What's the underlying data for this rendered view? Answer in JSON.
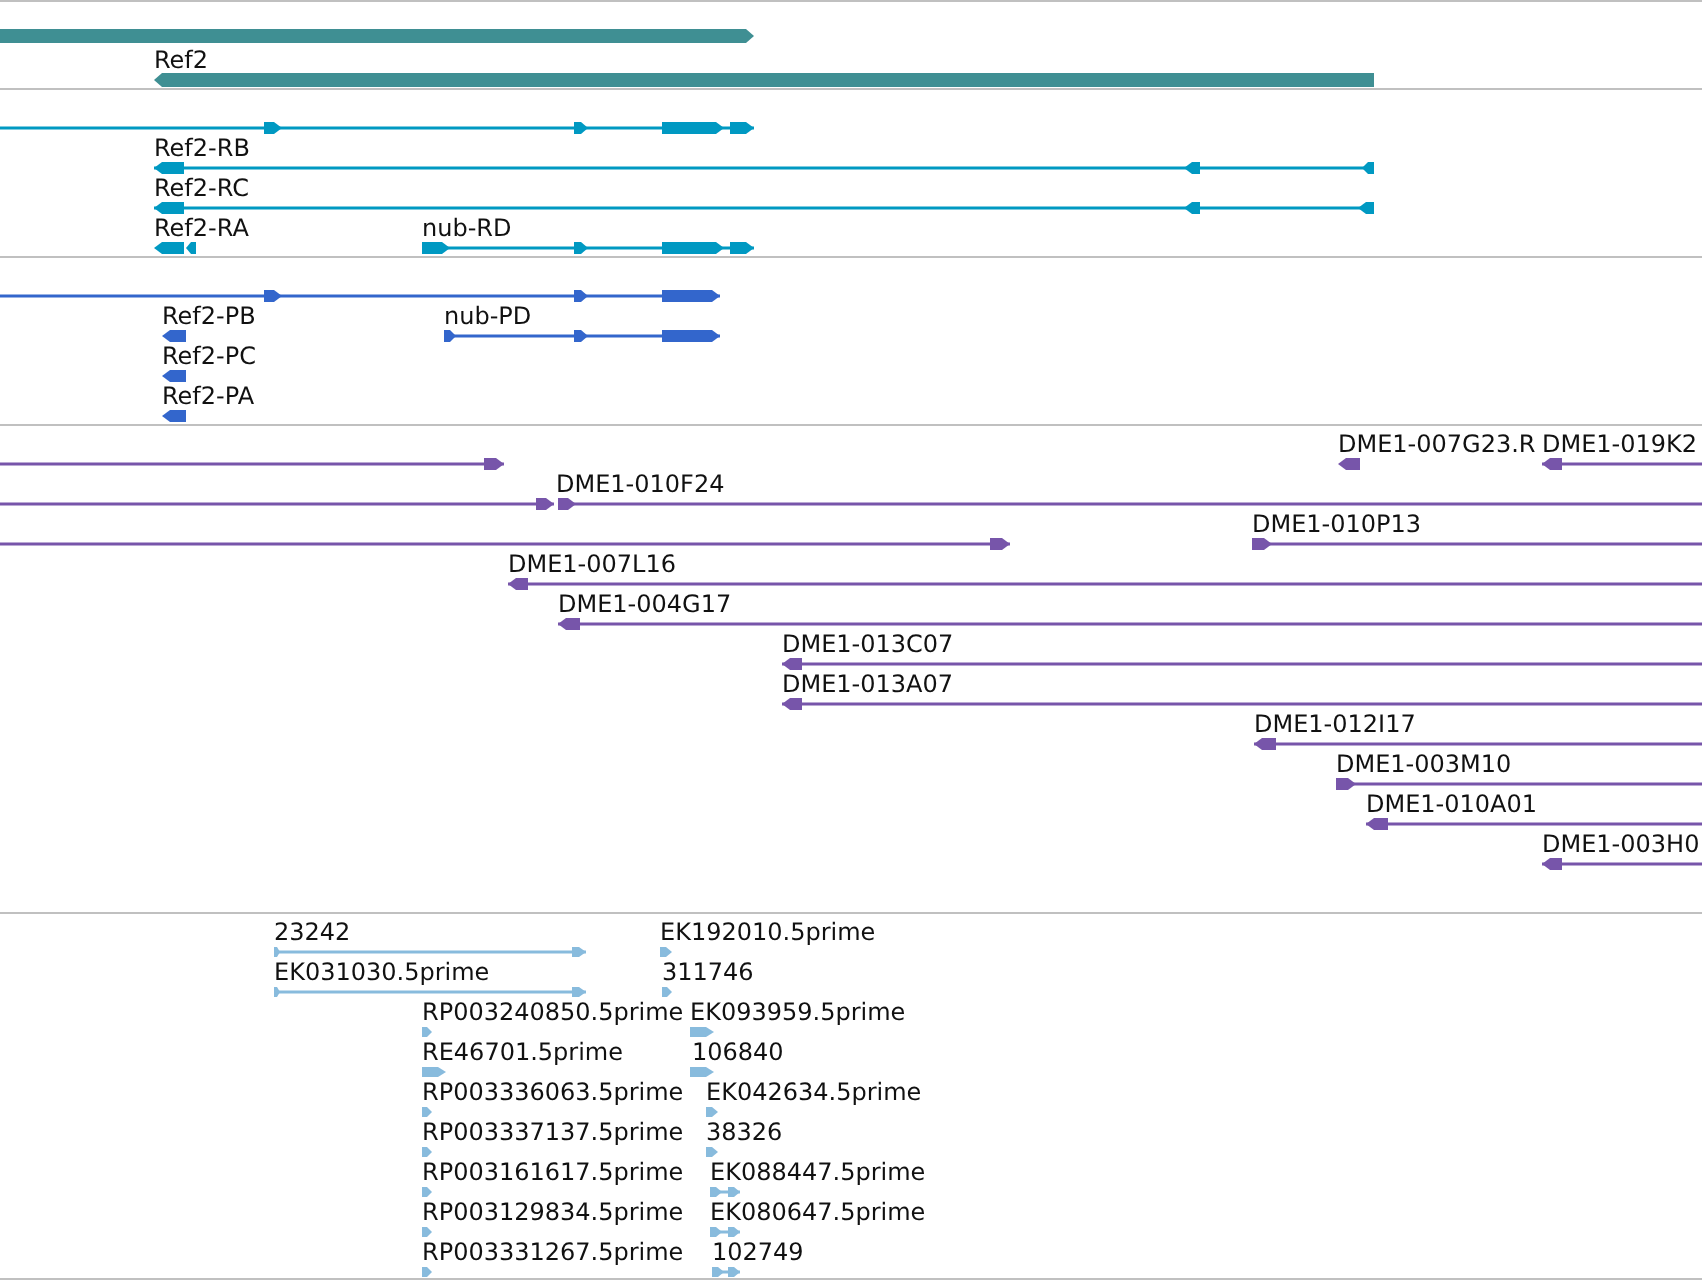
{
  "tracks": [
    {
      "kind": "gene",
      "features": [
        {
          "reverse": false
        },
        {
          "label": "Ref2",
          "reverse": true
        }
      ]
    },
    {
      "kind": "transcript",
      "features": [
        {
          "reverse": false
        },
        {
          "label": "Ref2-RB",
          "reverse": true
        },
        {
          "label": "Ref2-RC",
          "reverse": true
        },
        {
          "label": "Ref2-RA",
          "reverse": true
        },
        {
          "label": "nub-RD",
          "reverse": false
        }
      ]
    },
    {
      "kind": "protein",
      "features": [
        {
          "reverse": false
        },
        {
          "label": "Ref2-PB",
          "reverse": true
        },
        {
          "label": "nub-PD",
          "reverse": false
        },
        {
          "label": "Ref2-PC",
          "reverse": true
        },
        {
          "label": "Ref2-PA",
          "reverse": true
        }
      ]
    },
    {
      "kind": "clone",
      "features": [
        {
          "reverse": false
        },
        {
          "label": "DME1-007G23.R",
          "reverse": true
        },
        {
          "label": "DME1-019K2",
          "reverse": true
        },
        {
          "reverse": false
        },
        {
          "label": "DME1-010F24",
          "reverse": false
        },
        {
          "reverse": false
        },
        {
          "label": "DME1-010P13",
          "reverse": false
        },
        {
          "label": "DME1-007L16",
          "reverse": true
        },
        {
          "label": "DME1-004G17",
          "reverse": true
        },
        {
          "label": "DME1-013C07",
          "reverse": true
        },
        {
          "label": "DME1-013A07",
          "reverse": true
        },
        {
          "label": "DME1-012I17",
          "reverse": true
        },
        {
          "label": "DME1-003M10",
          "reverse": false
        },
        {
          "label": "DME1-010A01",
          "reverse": true
        },
        {
          "label": "DME1-003H0",
          "reverse": true
        }
      ]
    },
    {
      "kind": "est",
      "features": [
        {
          "label": "23242",
          "reverse": false
        },
        {
          "label": "EK031030.5prime",
          "reverse": false
        },
        {
          "label": "EK192010.5prime",
          "reverse": false
        },
        {
          "label": "311746",
          "reverse": false
        },
        {
          "label": "RP003240850.5prime",
          "reverse": false
        },
        {
          "label": "EK093959.5prime",
          "reverse": false
        },
        {
          "label": "RE46701.5prime",
          "reverse": false
        },
        {
          "label": "106840",
          "reverse": false
        },
        {
          "label": "RP003336063.5prime",
          "reverse": false
        },
        {
          "label": "EK042634.5prime",
          "reverse": false
        },
        {
          "label": "RP003337137.5prime",
          "reverse": false
        },
        {
          "label": "38326",
          "reverse": false
        },
        {
          "label": "RP003161617.5prime",
          "reverse": false
        },
        {
          "label": "EK088447.5prime",
          "reverse": false
        },
        {
          "label": "RP003129834.5prime",
          "reverse": false
        },
        {
          "label": "EK080647.5prime",
          "reverse": false
        },
        {
          "label": "RP003331267.5prime",
          "reverse": false
        },
        {
          "label": "102749",
          "reverse": false
        }
      ]
    }
  ]
}
